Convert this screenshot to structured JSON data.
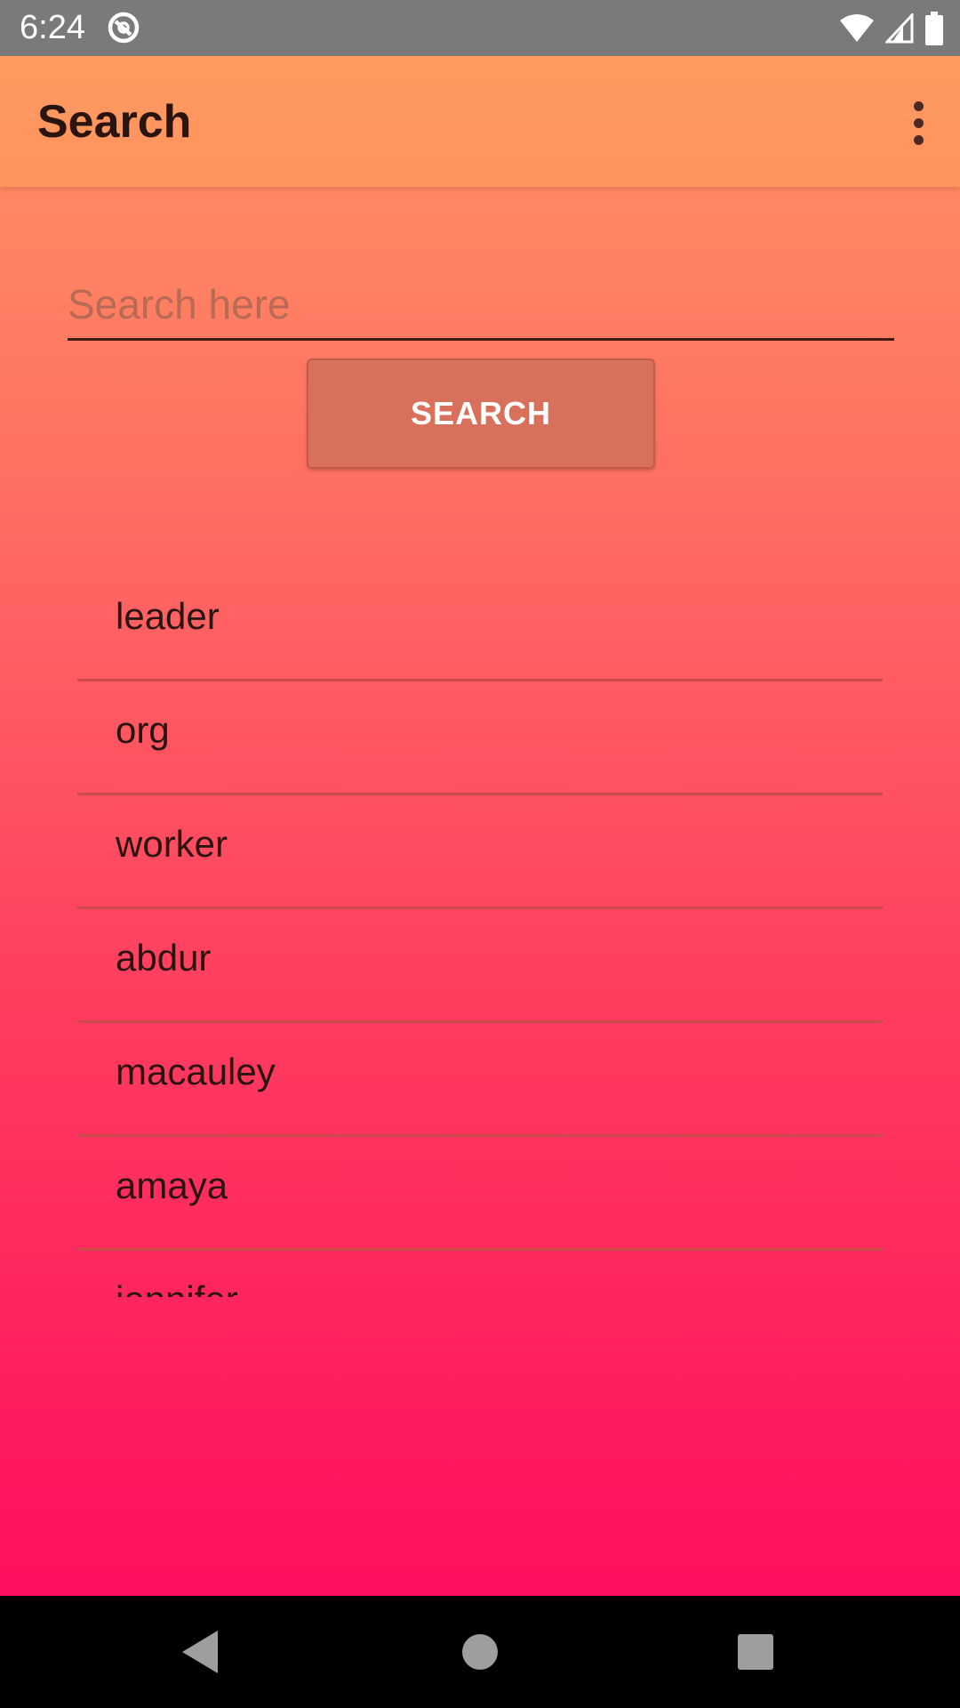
{
  "status_bar": {
    "time": "6:24"
  },
  "app_bar": {
    "title": "Search"
  },
  "search": {
    "placeholder": "Search here",
    "value": "",
    "button_label": "SEARCH"
  },
  "results": [
    "leader",
    "org",
    "worker",
    "abdur",
    "macauley",
    "amaya",
    "jennifer"
  ],
  "colors": {
    "gradient_top": "#ff9561",
    "gradient_bottom": "#ff0f5e",
    "button": "#d8705c"
  },
  "icons": {
    "status": [
      "do-not-disturb-icon",
      "wifi-icon",
      "cell-signal-icon",
      "battery-icon"
    ],
    "app_bar": [
      "overflow-menu-icon"
    ],
    "nav": [
      "back-icon",
      "home-icon",
      "recents-icon"
    ]
  }
}
